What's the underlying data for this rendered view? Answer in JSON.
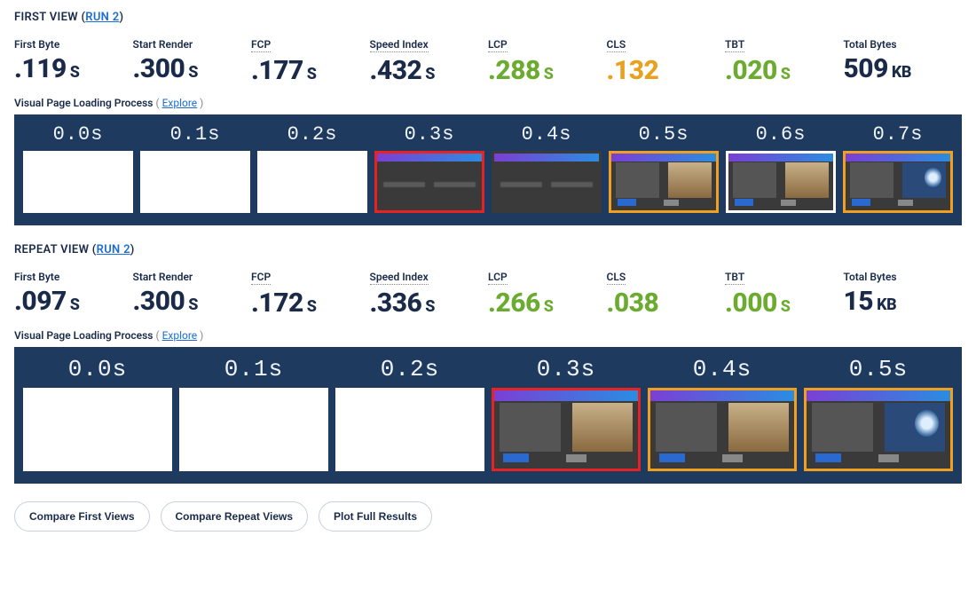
{
  "views": [
    {
      "id": "first",
      "title_prefix": "FIRST VIEW",
      "run_link": "RUN 2",
      "metrics": [
        {
          "label": "First Byte",
          "dotted": false,
          "value": ".119",
          "unit": "S",
          "color": ""
        },
        {
          "label": "Start Render",
          "dotted": false,
          "value": ".300",
          "unit": "S",
          "color": ""
        },
        {
          "label": "FCP",
          "dotted": true,
          "value": ".177",
          "unit": "S",
          "color": ""
        },
        {
          "label": "Speed Index",
          "dotted": true,
          "value": ".432",
          "unit": "S",
          "color": ""
        },
        {
          "label": "LCP",
          "dotted": true,
          "value": ".288",
          "unit": "S",
          "color": "green"
        },
        {
          "label": "CLS",
          "dotted": true,
          "value": ".132",
          "unit": "",
          "color": "orange"
        },
        {
          "label": "TBT",
          "dotted": true,
          "value": ".020",
          "unit": "S",
          "color": "green"
        },
        {
          "label": "Total Bytes",
          "dotted": false,
          "value": "509",
          "unit": "KB",
          "color": ""
        }
      ],
      "vpl_label": "Visual Page Loading Process",
      "explore": "Explore",
      "frames": [
        {
          "t": "0.0s",
          "kind": "blank",
          "border": ""
        },
        {
          "t": "0.1s",
          "kind": "blank",
          "border": ""
        },
        {
          "t": "0.2s",
          "kind": "blank",
          "border": ""
        },
        {
          "t": "0.3s",
          "kind": "dark-text",
          "border": "red"
        },
        {
          "t": "0.4s",
          "kind": "dark-text",
          "border": ""
        },
        {
          "t": "0.5s",
          "kind": "partial",
          "border": "orange"
        },
        {
          "t": "0.6s",
          "kind": "partial",
          "border": ""
        },
        {
          "t": "0.7s",
          "kind": "full",
          "border": "orange"
        }
      ]
    },
    {
      "id": "repeat",
      "title_prefix": "REPEAT VIEW",
      "run_link": "RUN 2",
      "metrics": [
        {
          "label": "First Byte",
          "dotted": false,
          "value": ".097",
          "unit": "S",
          "color": ""
        },
        {
          "label": "Start Render",
          "dotted": false,
          "value": ".300",
          "unit": "S",
          "color": ""
        },
        {
          "label": "FCP",
          "dotted": true,
          "value": ".172",
          "unit": "S",
          "color": ""
        },
        {
          "label": "Speed Index",
          "dotted": true,
          "value": ".336",
          "unit": "S",
          "color": ""
        },
        {
          "label": "LCP",
          "dotted": true,
          "value": ".266",
          "unit": "S",
          "color": "green"
        },
        {
          "label": "CLS",
          "dotted": true,
          "value": ".038",
          "unit": "",
          "color": "green"
        },
        {
          "label": "TBT",
          "dotted": true,
          "value": ".000",
          "unit": "S",
          "color": "green"
        },
        {
          "label": "Total Bytes",
          "dotted": false,
          "value": "15",
          "unit": "KB",
          "color": ""
        }
      ],
      "vpl_label": "Visual Page Loading Process",
      "explore": "Explore",
      "frames": [
        {
          "t": "0.0s",
          "kind": "blank",
          "border": ""
        },
        {
          "t": "0.1s",
          "kind": "blank",
          "border": ""
        },
        {
          "t": "0.2s",
          "kind": "blank",
          "border": ""
        },
        {
          "t": "0.3s",
          "kind": "partial",
          "border": "red"
        },
        {
          "t": "0.4s",
          "kind": "partial",
          "border": "orange"
        },
        {
          "t": "0.5s",
          "kind": "full",
          "border": "orange"
        }
      ]
    }
  ],
  "buttons": {
    "compare_first": "Compare First Views",
    "compare_repeat": "Compare Repeat Views",
    "plot_full": "Plot Full Results"
  },
  "chart_data": [
    {
      "type": "bar",
      "title": "First View metrics",
      "categories": [
        "First Byte",
        "Start Render",
        "FCP",
        "Speed Index",
        "LCP",
        "CLS",
        "TBT",
        "Total Bytes"
      ],
      "values": [
        0.119,
        0.3,
        0.177,
        0.432,
        0.288,
        0.132,
        0.02,
        509
      ],
      "units": [
        "s",
        "s",
        "s",
        "s",
        "s",
        "",
        "s",
        "KB"
      ]
    },
    {
      "type": "bar",
      "title": "Repeat View metrics",
      "categories": [
        "First Byte",
        "Start Render",
        "FCP",
        "Speed Index",
        "LCP",
        "CLS",
        "TBT",
        "Total Bytes"
      ],
      "values": [
        0.097,
        0.3,
        0.172,
        0.336,
        0.266,
        0.038,
        0.0,
        15
      ],
      "units": [
        "s",
        "s",
        "s",
        "s",
        "s",
        "",
        "s",
        "KB"
      ]
    }
  ]
}
